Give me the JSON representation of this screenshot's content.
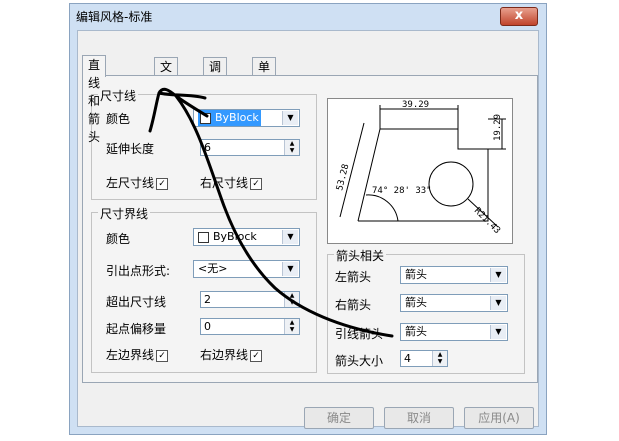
{
  "window": {
    "title": "编辑风格-标准",
    "close_label": "x"
  },
  "tabs": [
    {
      "label": "直线和箭头"
    },
    {
      "label": "文本"
    },
    {
      "label": "调整"
    },
    {
      "label": "单位和精度相关"
    }
  ],
  "dim_line": {
    "group_label": "尺寸线",
    "color_label": "颜色",
    "color_value": "ByBlock",
    "extend_label": "延伸长度",
    "extend_value": "6",
    "left_label": "左尺寸线",
    "right_label": "右尺寸线",
    "left_checked": true,
    "right_checked": true
  },
  "ext_line": {
    "group_label": "尺寸界线",
    "color_label": "颜色",
    "color_value": "ByBlock",
    "origin_style_label": "引出点形式:",
    "origin_style_value": "<无>",
    "beyond_label": "超出尺寸线",
    "beyond_value": "2",
    "offset_label": "起点偏移量",
    "offset_value": "0",
    "left_label": "左边界线",
    "right_label": "右边界线",
    "left_checked": true,
    "right_checked": true
  },
  "arrows": {
    "group_label": "箭头相关",
    "left_label": "左箭头",
    "left_value": "箭头",
    "right_label": "右箭头",
    "right_value": "箭头",
    "leader_label": "引线箭头",
    "leader_value": "箭头",
    "size_label": "箭头大小",
    "size_value": "4"
  },
  "preview": {
    "dim_top": "39.29",
    "dim_right": "19.29",
    "dim_left": "53.28",
    "dim_angle": "74° 28' 33\"",
    "dim_radius": "R21.43"
  },
  "buttons": {
    "ok": "确定",
    "cancel": "取消",
    "apply": "应用(A)"
  },
  "check_mark": "✓",
  "combo_arrow": "▼",
  "spin_up": "▲",
  "spin_down": "▼"
}
